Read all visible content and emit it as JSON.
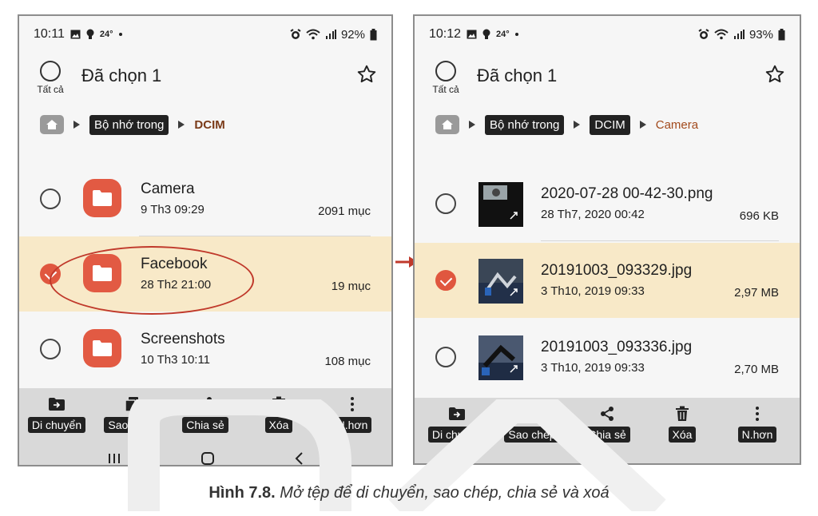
{
  "left_screen": {
    "status": {
      "time": "10:11",
      "temp": "24°",
      "battery": "92%"
    },
    "appbar": {
      "select_all_label": "Tất cả",
      "title": "Đã chọn 1"
    },
    "breadcrumb": {
      "chips": [
        "Bộ nhớ trong"
      ],
      "current": "DCIM"
    },
    "items": [
      {
        "name": "Camera",
        "date": "9 Th3 09:29",
        "size": "2091 mục",
        "selected": false
      },
      {
        "name": "Facebook",
        "date": "28 Th2 21:00",
        "size": "19 mục",
        "selected": true
      },
      {
        "name": "Screenshots",
        "date": "10 Th3 10:11",
        "size": "108 mục",
        "selected": false
      }
    ],
    "actions": [
      {
        "label": "Di chuyển",
        "icon": "move-icon"
      },
      {
        "label": "Sao chép",
        "icon": "copy-icon"
      },
      {
        "label": "Chia sẻ",
        "icon": "share-icon"
      },
      {
        "label": "Xóa",
        "icon": "trash-icon"
      },
      {
        "label": "N.hơn",
        "icon": "more-icon"
      }
    ]
  },
  "right_screen": {
    "status": {
      "time": "10:12",
      "temp": "24°",
      "battery": "93%"
    },
    "appbar": {
      "select_all_label": "Tất cả",
      "title": "Đã chọn 1"
    },
    "breadcrumb": {
      "chips": [
        "Bộ nhớ trong",
        "DCIM"
      ],
      "current": "Camera"
    },
    "items": [
      {
        "name": "2020-07-28 00-42-30.png",
        "date": "28 Th7, 2020 00:42",
        "size": "696 KB",
        "selected": false
      },
      {
        "name": "20191003_093329.jpg",
        "date": "3 Th10, 2019 09:33",
        "size": "2,97 MB",
        "selected": true
      },
      {
        "name": "20191003_093336.jpg",
        "date": "3 Th10, 2019 09:33",
        "size": "2,70 MB",
        "selected": false
      }
    ],
    "actions": [
      {
        "label": "Di chuyển",
        "icon": "move-icon"
      },
      {
        "label": "Sao chép",
        "icon": "copy-icon"
      },
      {
        "label": "Chia sẻ",
        "icon": "share-icon"
      },
      {
        "label": "Xóa",
        "icon": "trash-icon"
      },
      {
        "label": "N.hơn",
        "icon": "more-icon"
      }
    ]
  },
  "caption": {
    "figure": "Hình 7.8.",
    "text": "Mở tệp để di chuyển, sao chép, chia sẻ và xoá"
  },
  "colors": {
    "accent": "#e25a43",
    "selected_row": "#f8e9c8",
    "arrow": "#c0392b"
  }
}
